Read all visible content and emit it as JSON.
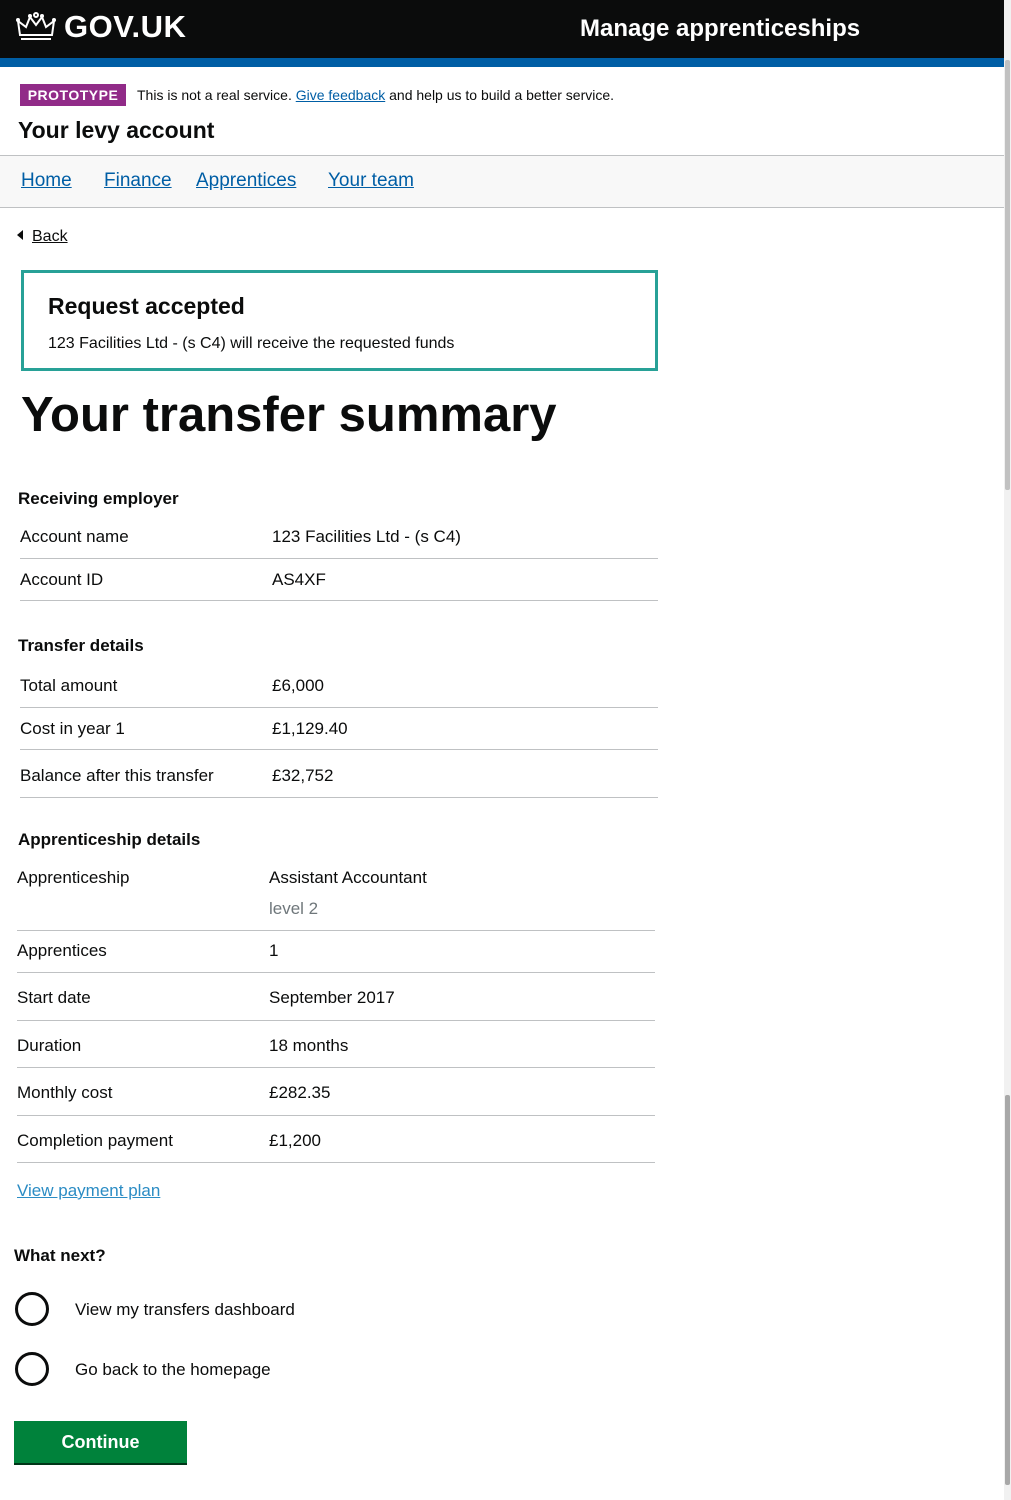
{
  "header": {
    "logo_text": "GOV.UK",
    "service_name": "Manage apprenticeships"
  },
  "phase_banner": {
    "tag": "PROTOTYPE",
    "text_before": "This is not a real service. ",
    "link": "Give feedback",
    "text_after": " and help us to build a better service."
  },
  "account_title": "Your levy account",
  "nav": {
    "home": "Home",
    "finance": "Finance",
    "apprentices": "Apprentices",
    "team": "Your team"
  },
  "back_link": "Back",
  "confirmation": {
    "title": "Request accepted",
    "body": "123 Facilities Ltd - (s C4) will receive the requested funds"
  },
  "page_title": "Your transfer summary",
  "receiving_employer": {
    "heading": "Receiving employer",
    "rows": [
      {
        "key": "Account name",
        "value": "123 Facilities Ltd - (s C4)"
      },
      {
        "key": "Account ID",
        "value": "AS4XF"
      }
    ]
  },
  "transfer_details": {
    "heading": "Transfer details",
    "rows": [
      {
        "key": "Total amount",
        "value": "£6,000"
      },
      {
        "key": "Cost in year 1",
        "value": "£1,129.40"
      },
      {
        "key": "Balance after this transfer",
        "value": "£32,752"
      }
    ]
  },
  "apprenticeship_details": {
    "heading": "Apprenticeship details",
    "rows": [
      {
        "key": "Apprenticeship",
        "value": "Assistant Accountant",
        "sub": "level 2"
      },
      {
        "key": "Apprentices",
        "value": "1"
      },
      {
        "key": "Start date",
        "value": "September 2017"
      },
      {
        "key": "Duration",
        "value": "18 months"
      },
      {
        "key": "Monthly cost",
        "value": "£282.35"
      },
      {
        "key": "Completion payment",
        "value": "£1,200"
      }
    ]
  },
  "payment_plan_link": "View payment plan",
  "what_next": {
    "heading": "What next?",
    "options": [
      {
        "label": "View my transfers dashboard",
        "selected": false
      },
      {
        "label": "Go back to the homepage",
        "selected": false
      }
    ]
  },
  "continue_button": "Continue",
  "colors": {
    "header_bg": "#0b0c0c",
    "header_bar": "#005ea5",
    "prototype_tag": "#912b88",
    "panel_border": "#28a197",
    "button_green": "#00823b",
    "link": "#005ea5"
  }
}
